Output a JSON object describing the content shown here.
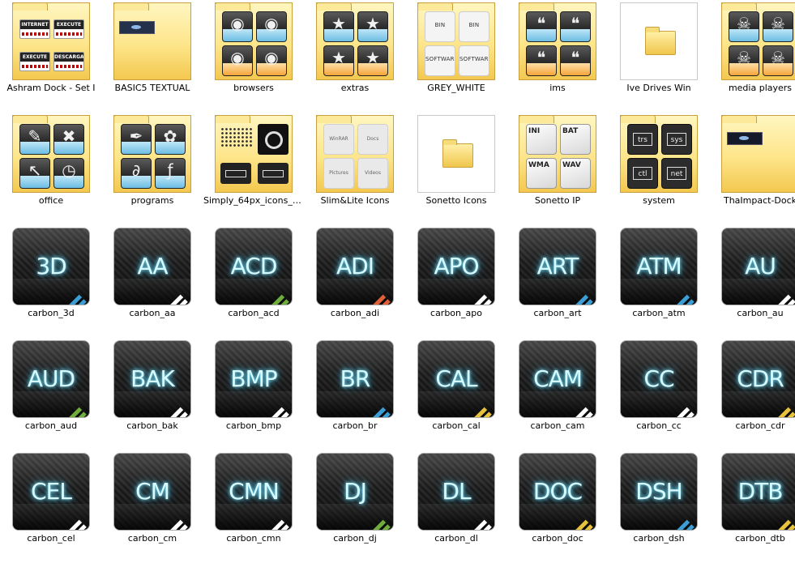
{
  "folders": [
    {
      "name": "Ashram Dock - Set I",
      "kind": "ashram"
    },
    {
      "name": "BASIC5 TEXTUAL",
      "kind": "basic5"
    },
    {
      "name": "browsers",
      "kind": "tiles",
      "glyph": "◉",
      "icon": "rss-icon"
    },
    {
      "name": "extras",
      "kind": "tiles",
      "glyph": "★",
      "icon": "star-icon"
    },
    {
      "name": "GREY_WHITE",
      "kind": "greywhite"
    },
    {
      "name": "ims",
      "kind": "tiles",
      "glyph": "❝",
      "icon": "quote-icon"
    },
    {
      "name": "Ive Drives Win",
      "kind": "plain"
    },
    {
      "name": "media players",
      "kind": "tiles",
      "glyph": "☠",
      "icon": "fox-icon"
    },
    {
      "name": "office",
      "kind": "office"
    },
    {
      "name": "programs",
      "kind": "programs"
    },
    {
      "name": "Simply_64px_icons_b...",
      "kind": "simply"
    },
    {
      "name": "Slim&Lite Icons",
      "kind": "slim"
    },
    {
      "name": "Sonetto Icons",
      "kind": "plain"
    },
    {
      "name": "Sonetto IP",
      "kind": "sonetto"
    },
    {
      "name": "system",
      "kind": "system"
    },
    {
      "name": "ThaImpact-Dock",
      "kind": "thaimpact"
    }
  ],
  "ashram_labels": [
    "INTERNET",
    "EXECUTE",
    "EXECUTE",
    "DESCARGA"
  ],
  "greywhite_labels": [
    "BIN",
    "BIN",
    "SOFTWARE",
    "SOFTWARE"
  ],
  "slim_labels": [
    "WinRAR",
    "Docs",
    "Pictures",
    "Videos"
  ],
  "sonetto_labels": [
    "INI",
    "BAT",
    "WMA",
    "WAV"
  ],
  "system_labels": [
    "trs",
    "sys",
    "ctl",
    "net"
  ],
  "office_glyphs": [
    "✎",
    "✖",
    "↖",
    "◷"
  ],
  "programs_glyphs": [
    "✒",
    "✿",
    "∂",
    "ƒ"
  ],
  "carbon": [
    {
      "name": "carbon_3d",
      "text": "3D",
      "stripe": "#3b9fd6"
    },
    {
      "name": "carbon_aa",
      "text": "AA",
      "stripe": "#ffffff"
    },
    {
      "name": "carbon_acd",
      "text": "ACD",
      "stripe": "#6fae3c"
    },
    {
      "name": "carbon_adi",
      "text": "ADI",
      "stripe": "#e0603a"
    },
    {
      "name": "carbon_apo",
      "text": "APO",
      "stripe": "#ffffff"
    },
    {
      "name": "carbon_art",
      "text": "ART",
      "stripe": "#3b9fd6"
    },
    {
      "name": "carbon_atm",
      "text": "ATM",
      "stripe": "#3b9fd6"
    },
    {
      "name": "carbon_au",
      "text": "AU",
      "stripe": "#ffffff"
    },
    {
      "name": "carbon_aud",
      "text": "AUD",
      "stripe": "#6fae3c"
    },
    {
      "name": "carbon_bak",
      "text": "BAK",
      "stripe": "#ffffff"
    },
    {
      "name": "carbon_bmp",
      "text": "BMP",
      "stripe": "#ffffff"
    },
    {
      "name": "carbon_br",
      "text": "BR",
      "stripe": "#3b9fd6"
    },
    {
      "name": "carbon_cal",
      "text": "CAL",
      "stripe": "#e8c23a"
    },
    {
      "name": "carbon_cam",
      "text": "CAM",
      "stripe": "#ffffff"
    },
    {
      "name": "carbon_cc",
      "text": "CC",
      "stripe": "#ffffff"
    },
    {
      "name": "carbon_cdr",
      "text": "CDR",
      "stripe": "#e8c23a"
    },
    {
      "name": "carbon_cel",
      "text": "CEL",
      "stripe": "#ffffff"
    },
    {
      "name": "carbon_cm",
      "text": "CM",
      "stripe": "#ffffff"
    },
    {
      "name": "carbon_cmn",
      "text": "CMN",
      "stripe": "#ffffff"
    },
    {
      "name": "carbon_dj",
      "text": "DJ",
      "stripe": "#6fae3c"
    },
    {
      "name": "carbon_dl",
      "text": "DL",
      "stripe": "#ffffff"
    },
    {
      "name": "carbon_doc",
      "text": "DOC",
      "stripe": "#e8c23a"
    },
    {
      "name": "carbon_dsh",
      "text": "DSH",
      "stripe": "#3b9fd6"
    },
    {
      "name": "carbon_dtb",
      "text": "DTB",
      "stripe": "#e8c23a"
    }
  ]
}
